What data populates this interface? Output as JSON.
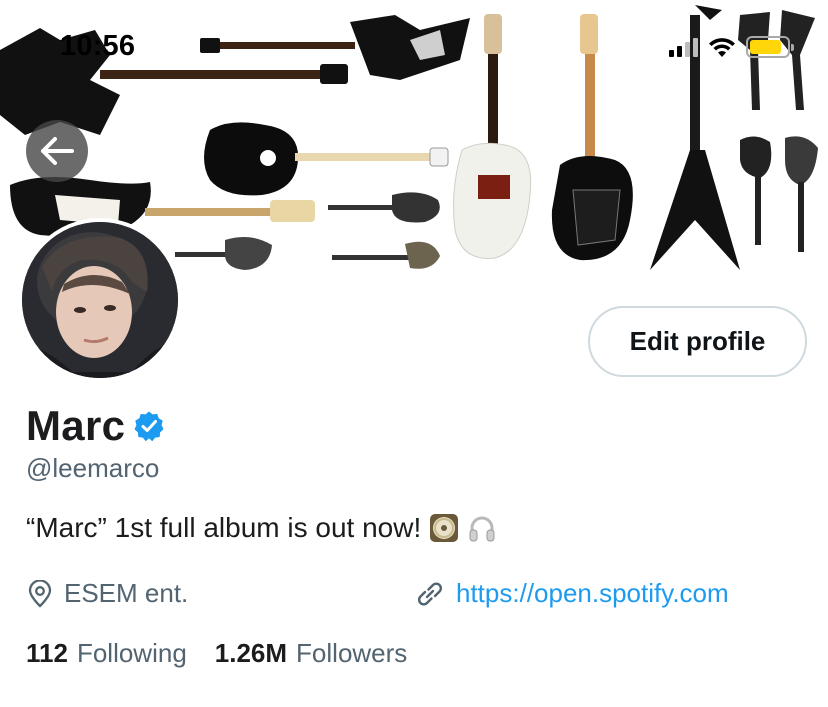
{
  "status_bar": {
    "time": "10:56",
    "signal_bars": 4,
    "signal_bars_active": 2,
    "battery_level": 0.85,
    "battery_color": "#ffd60a"
  },
  "header": {
    "back_icon": "arrow-left-icon",
    "banner_description": "guitars"
  },
  "profile": {
    "display_name": "Marc",
    "verified_icon": "verified-badge-icon",
    "verified_color": "#1d9bf0",
    "handle": "@leemarco",
    "edit_button_label": "Edit profile",
    "bio_text": "“Marc” 1st full album is out now!",
    "bio_emojis": [
      "cd-disc-icon",
      "headphones-icon"
    ],
    "location_icon": "location-pin-icon",
    "location": "ESEM ent.",
    "link_icon": "link-icon",
    "link": "https://open.spotify.com",
    "following_count": "112",
    "following_label": "Following",
    "followers_count": "1.26M",
    "followers_label": "Followers"
  },
  "colors": {
    "text_primary": "#0f1419",
    "text_secondary": "#536471",
    "link": "#1d9bf0",
    "button_border": "#cfd9de"
  }
}
